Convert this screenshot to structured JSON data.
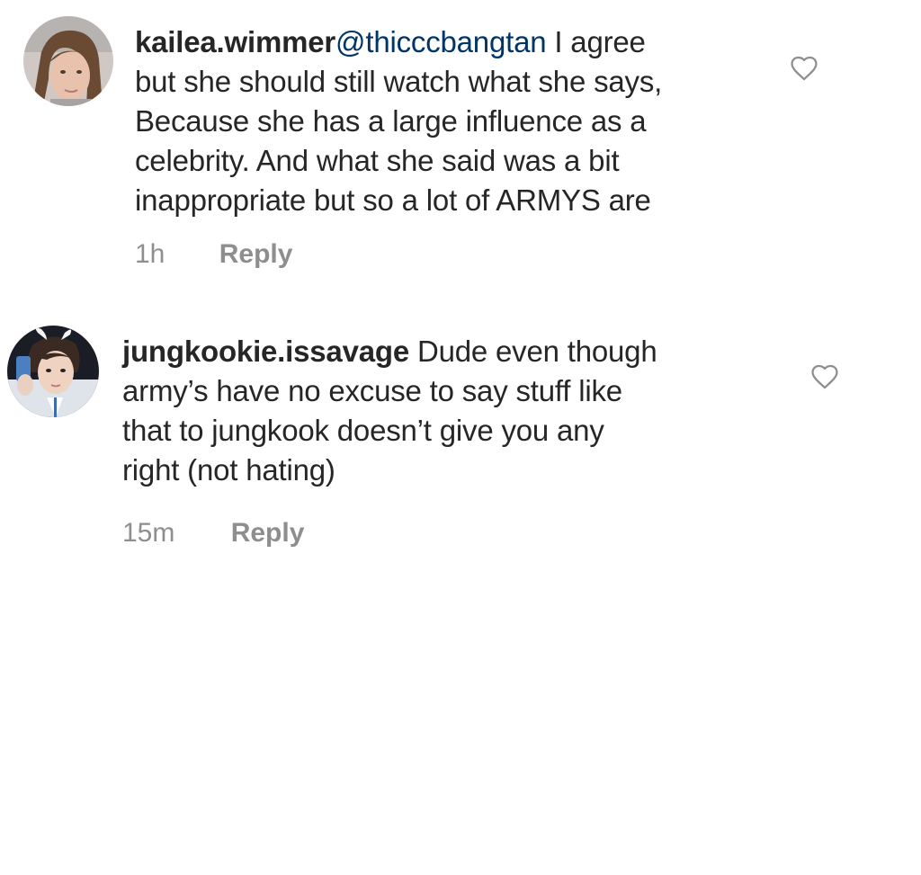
{
  "comments": [
    {
      "username": "kailea.wimmer",
      "mention": "@thicccbangtan",
      "text_lines": [
        " I agree",
        "but she should still watch what she says,",
        "Because she has a large influence as a",
        "celebrity. And what she said was a bit",
        "inappropriate but so a lot of ARMYS are"
      ],
      "time": "1h",
      "reply_label": "Reply",
      "avatar_icon": "avatar-girl-photo",
      "like_icon": "heart-outline-icon"
    },
    {
      "username": "jungkookie.issavage",
      "text_lines": [
        " Dude even though",
        "army’s have no excuse to say stuff like",
        "that to jungkook doesn’t give you any",
        "right (not hating)"
      ],
      "time": "15m",
      "reply_label": "Reply",
      "avatar_icon": "avatar-boy-photo",
      "like_icon": "heart-outline-icon"
    }
  ],
  "colors": {
    "text": "#262626",
    "mention": "#003569",
    "muted": "#8e8e8e"
  }
}
